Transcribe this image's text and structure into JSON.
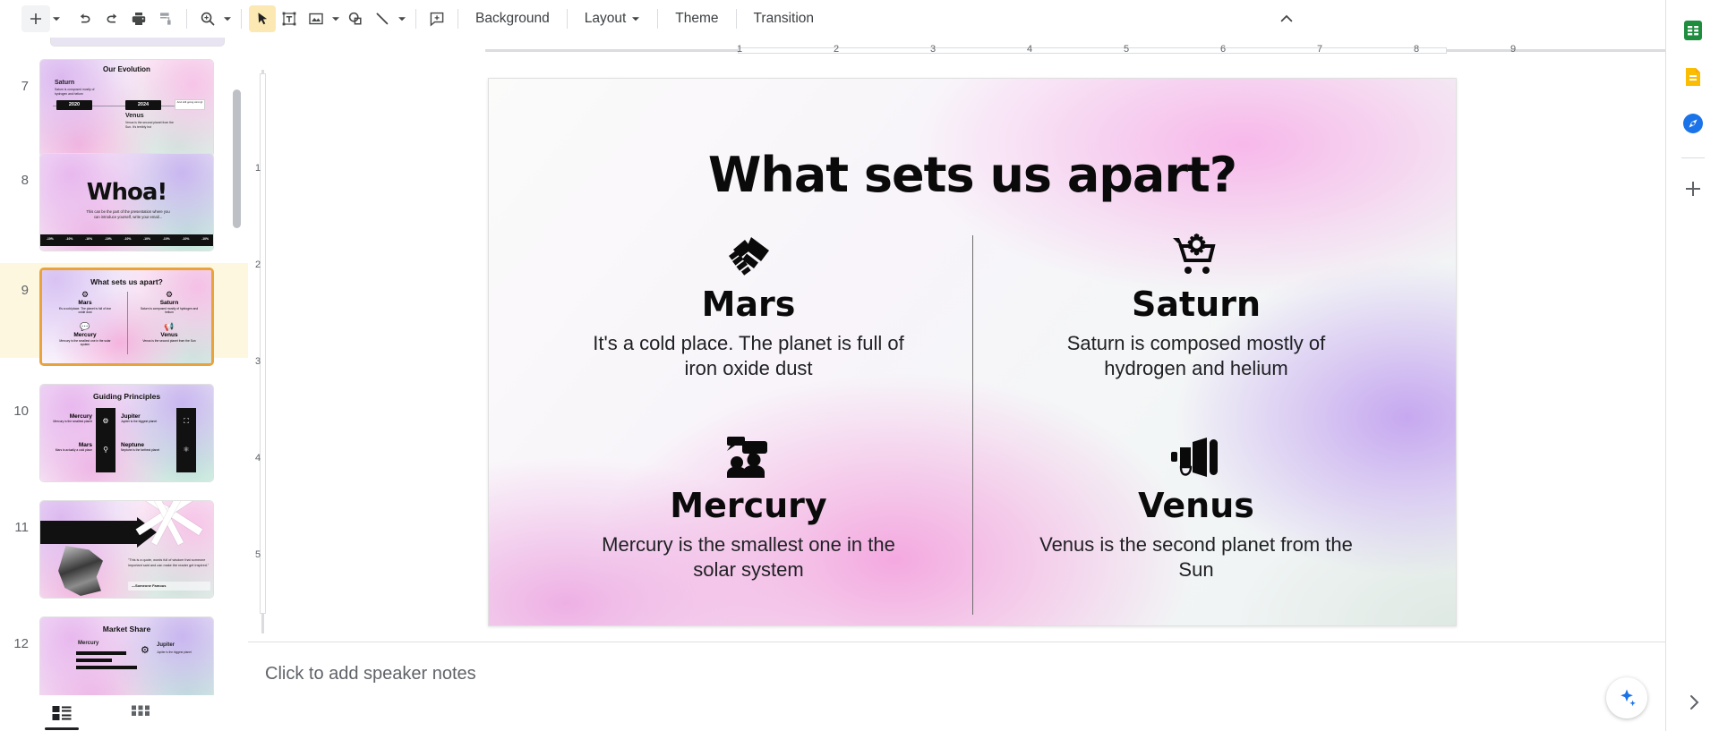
{
  "toolbar": {
    "new_slide_label": "new-slide",
    "buttons": [
      {
        "name": "new-slide-button",
        "icon": "plus-icon"
      },
      {
        "name": "new-slide-dropdown",
        "icon": "caret-down-icon"
      },
      {
        "name": "undo-button",
        "icon": "undo-icon"
      },
      {
        "name": "redo-button",
        "icon": "redo-icon"
      },
      {
        "name": "print-button",
        "icon": "print-icon"
      },
      {
        "name": "paint-format-button",
        "icon": "paint-format-icon"
      },
      {
        "name": "zoom-button",
        "icon": "zoom-in-icon"
      },
      {
        "name": "zoom-dropdown",
        "icon": "caret-down-icon"
      },
      {
        "name": "select-tool-button",
        "icon": "cursor-arrow-icon"
      },
      {
        "name": "text-box-button",
        "icon": "text-box-icon"
      },
      {
        "name": "insert-image-button",
        "icon": "image-icon"
      },
      {
        "name": "insert-image-dropdown",
        "icon": "caret-down-icon"
      },
      {
        "name": "shape-button",
        "icon": "shape-icon"
      },
      {
        "name": "line-button",
        "icon": "line-icon"
      },
      {
        "name": "line-dropdown",
        "icon": "caret-down-icon"
      },
      {
        "name": "comment-button",
        "icon": "add-comment-icon"
      }
    ],
    "background_label": "Background",
    "layout_label": "Layout",
    "theme_label": "Theme",
    "transition_label": "Transition",
    "collapse_label": "collapse-menu"
  },
  "filmstrip": {
    "slides": [
      {
        "number": "7",
        "selected": false,
        "style": "grad-a",
        "title": "Our Evolution",
        "items": [
          {
            "label": "Saturn",
            "desc": "Saturn is composed mostly of hydrogen and helium"
          },
          {
            "label": "Venus",
            "desc": "Venus is the second planet from the Sun. It's terribly hot"
          }
        ],
        "chips": [
          "2020",
          "2024"
        ],
        "note": "And still going strong!"
      },
      {
        "number": "8",
        "selected": false,
        "style": "grad-b",
        "title": "Whoa!",
        "subtitle": "This can be the part of the presentation where you can introduce yourself, write your email..."
      },
      {
        "number": "9",
        "selected": true,
        "style": "grad-c",
        "title": "What sets us apart?",
        "items": [
          {
            "label": "Mars",
            "desc": "It's a cold place. The planet is full of iron oxide dust"
          },
          {
            "label": "Saturn",
            "desc": "Saturn is composed mostly of hydrogen and helium"
          },
          {
            "label": "Mercury",
            "desc": "Mercury is the smallest one in the solar system"
          },
          {
            "label": "Venus",
            "desc": "Venus is the second planet from the Sun"
          }
        ]
      },
      {
        "number": "10",
        "selected": false,
        "style": "grad-b",
        "title": "Guiding Principles",
        "items": [
          {
            "label": "Mercury",
            "desc": "Mercury is the smallest planet"
          },
          {
            "label": "Jupiter",
            "desc": "Jupiter is the biggest planet"
          },
          {
            "label": "Mars",
            "desc": "Mars is actually a cold place"
          },
          {
            "label": "Neptune",
            "desc": "Neptune is the farthest planet"
          }
        ]
      },
      {
        "number": "11",
        "selected": false,
        "style": "grad-a",
        "quote": "\"This is a quote, words full of wisdom that someone important said and can make the reader get inspired.\"",
        "author": "—Someone Famous"
      },
      {
        "number": "12",
        "selected": false,
        "style": "grad-b",
        "title": "Market Share",
        "items": [
          {
            "label": "Mercury",
            "desc": ""
          },
          {
            "label": "Jupiter",
            "desc": "Jupiter is the biggest planet"
          }
        ]
      }
    ],
    "bottom": {
      "filmstrip_view_label": "filmstrip-view",
      "grid_view_label": "grid-view"
    }
  },
  "ruler": {
    "horizontal_labels": [
      "1",
      "2",
      "3",
      "4",
      "5",
      "6",
      "7",
      "8",
      "9"
    ],
    "vertical_labels": [
      "1",
      "2",
      "3",
      "4",
      "5"
    ]
  },
  "slide": {
    "title": "What sets us apart?",
    "quadrants": [
      {
        "icon": "handshake-icon",
        "title": "Mars",
        "desc": "It's a cold place. The planet is full of iron oxide dust"
      },
      {
        "icon": "cart-gear-icon",
        "title": "Saturn",
        "desc": "Saturn is composed mostly of hydrogen and helium"
      },
      {
        "icon": "people-chat-icon",
        "title": "Mercury",
        "desc": "Mercury is the smallest one in the solar system"
      },
      {
        "icon": "megaphone-icon",
        "title": "Venus",
        "desc": "Venus is the second planet from the Sun"
      }
    ]
  },
  "notes": {
    "placeholder": "Click to add speaker notes"
  },
  "rail": {
    "items": [
      {
        "name": "sheets-app-icon",
        "color": "#1e8e3e"
      },
      {
        "name": "keep-app-icon",
        "color": "#fbbc04"
      },
      {
        "name": "maps-app-icon",
        "color": "#1a73e8"
      },
      {
        "name": "add-app-icon",
        "color": "#5f6368"
      }
    ],
    "expand_label": "expand-side-panel"
  },
  "explore": {
    "label": "explore-button"
  },
  "colors": {
    "accent": "#e8a33d",
    "selected_row_bg": "#fef7e0",
    "tool_active_bg": "#fce8b2",
    "text_primary": "#3c4043",
    "text_secondary": "#5f6368"
  }
}
